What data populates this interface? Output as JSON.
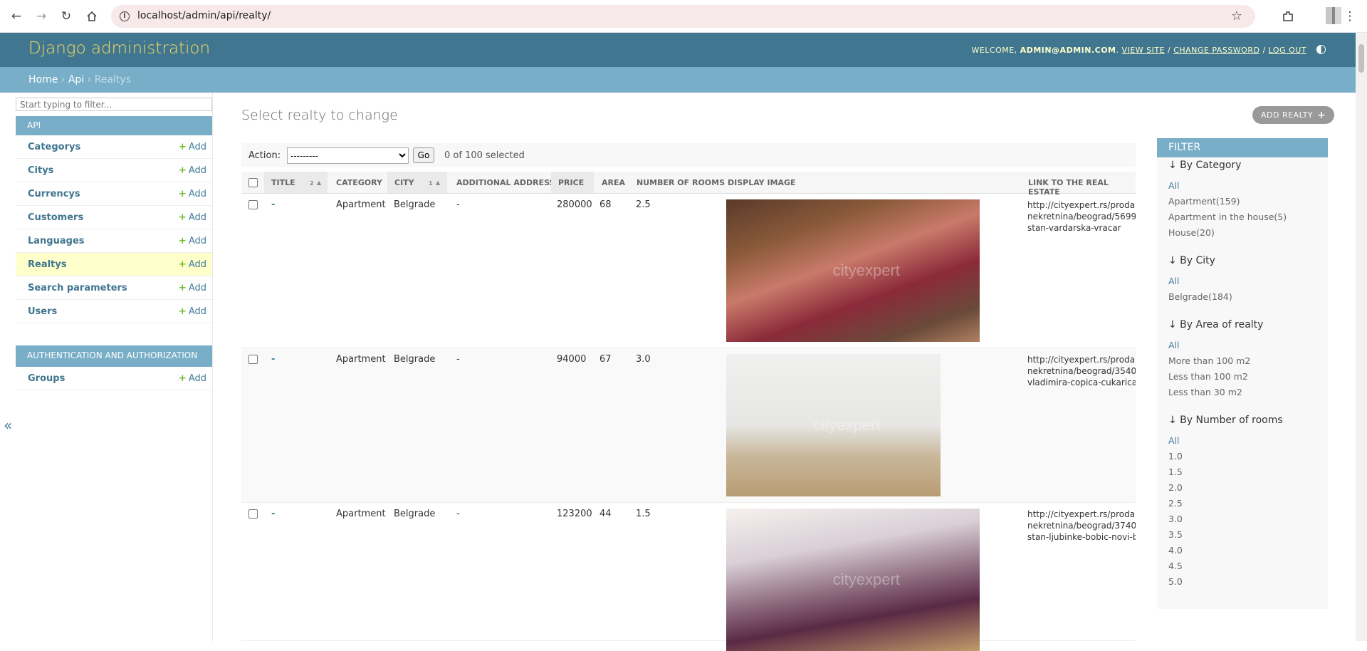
{
  "browser": {
    "url": "localhost/admin/api/realty/"
  },
  "header": {
    "site_title": "Django administration",
    "welcome": "Welcome,",
    "user": "admin@admin.com",
    "view_site": "View site",
    "change_password": "Change password",
    "log_out": "Log out"
  },
  "breadcrumbs": {
    "home": "Home",
    "app": "Api",
    "current": "Realtys",
    "sep": "›"
  },
  "sidebar": {
    "filter_placeholder": "Start typing to filter...",
    "api_caption": "API",
    "add_label": "Add",
    "api_models": [
      {
        "label": "Categorys"
      },
      {
        "label": "Citys"
      },
      {
        "label": "Currencys"
      },
      {
        "label": "Customers"
      },
      {
        "label": "Languages"
      },
      {
        "label": "Realtys"
      },
      {
        "label": "Search parameters"
      },
      {
        "label": "Users"
      }
    ],
    "auth_caption": "Authentication and Authorization",
    "auth_models": [
      {
        "label": "Groups"
      }
    ],
    "collapse": "«"
  },
  "content": {
    "title": "Select realty to change",
    "add_button": "Add realty",
    "action_label": "Action:",
    "action_select": "---------",
    "go_button": "Go",
    "selected_counter": "0 of 100 selected"
  },
  "table": {
    "columns": {
      "title": "Title",
      "title_sort": "2",
      "category": "Category",
      "city": "City",
      "city_sort": "1",
      "additional_address": "Additional address",
      "price": "Price",
      "area": "Area",
      "rooms": "Number of rooms",
      "display_image": "Display image",
      "link": "Link to the real estate"
    },
    "rows": [
      {
        "title": "-",
        "category": "Apartment",
        "city": "Belgrade",
        "address": "-",
        "price": "280000",
        "area": "68",
        "rooms": "2.5",
        "link1": "http://cityexpert.rs/proda",
        "link2": "nekretnina/beograd/5699",
        "link3": "stan-vardarska-vracar"
      },
      {
        "title": "-",
        "category": "Apartment",
        "city": "Belgrade",
        "address": "-",
        "price": "94000",
        "area": "67",
        "rooms": "3.0",
        "link1": "http://cityexpert.rs/proda",
        "link2": "nekretnina/beograd/3540",
        "link3": "vladimira-copica-cukarica"
      },
      {
        "title": "-",
        "category": "Apartment",
        "city": "Belgrade",
        "address": "-",
        "price": "123200",
        "area": "44",
        "rooms": "1.5",
        "link1": "http://cityexpert.rs/proda",
        "link2": "nekretnina/beograd/3740",
        "link3": "stan-ljubinke-bobic-novi-b"
      }
    ],
    "watermark": "cityexpert"
  },
  "filter": {
    "heading": "Filter",
    "sections": [
      {
        "title": "↓ By Category",
        "options": [
          "All",
          "Apartment(159)",
          "Apartment in the house(5)",
          "House(20)"
        ]
      },
      {
        "title": "↓ By City",
        "options": [
          "All",
          "Belgrade(184)"
        ]
      },
      {
        "title": "↓ By Area of realty",
        "options": [
          "All",
          "More than 100 m2",
          "Less than 100 m2",
          "Less than 30 m2"
        ]
      },
      {
        "title": "↓ By Number of rooms",
        "options": [
          "All",
          "1.0",
          "1.5",
          "2.0",
          "2.5",
          "3.0",
          "3.5",
          "4.0",
          "4.5",
          "5.0"
        ]
      }
    ]
  },
  "colors": {
    "header_bg": "#417690",
    "breadcrumb_bg": "#79aec8",
    "site_title": "#f5dd5d",
    "link": "#447e9b",
    "add_plus": "#70bf2b",
    "active_row": "#ffffcc"
  }
}
